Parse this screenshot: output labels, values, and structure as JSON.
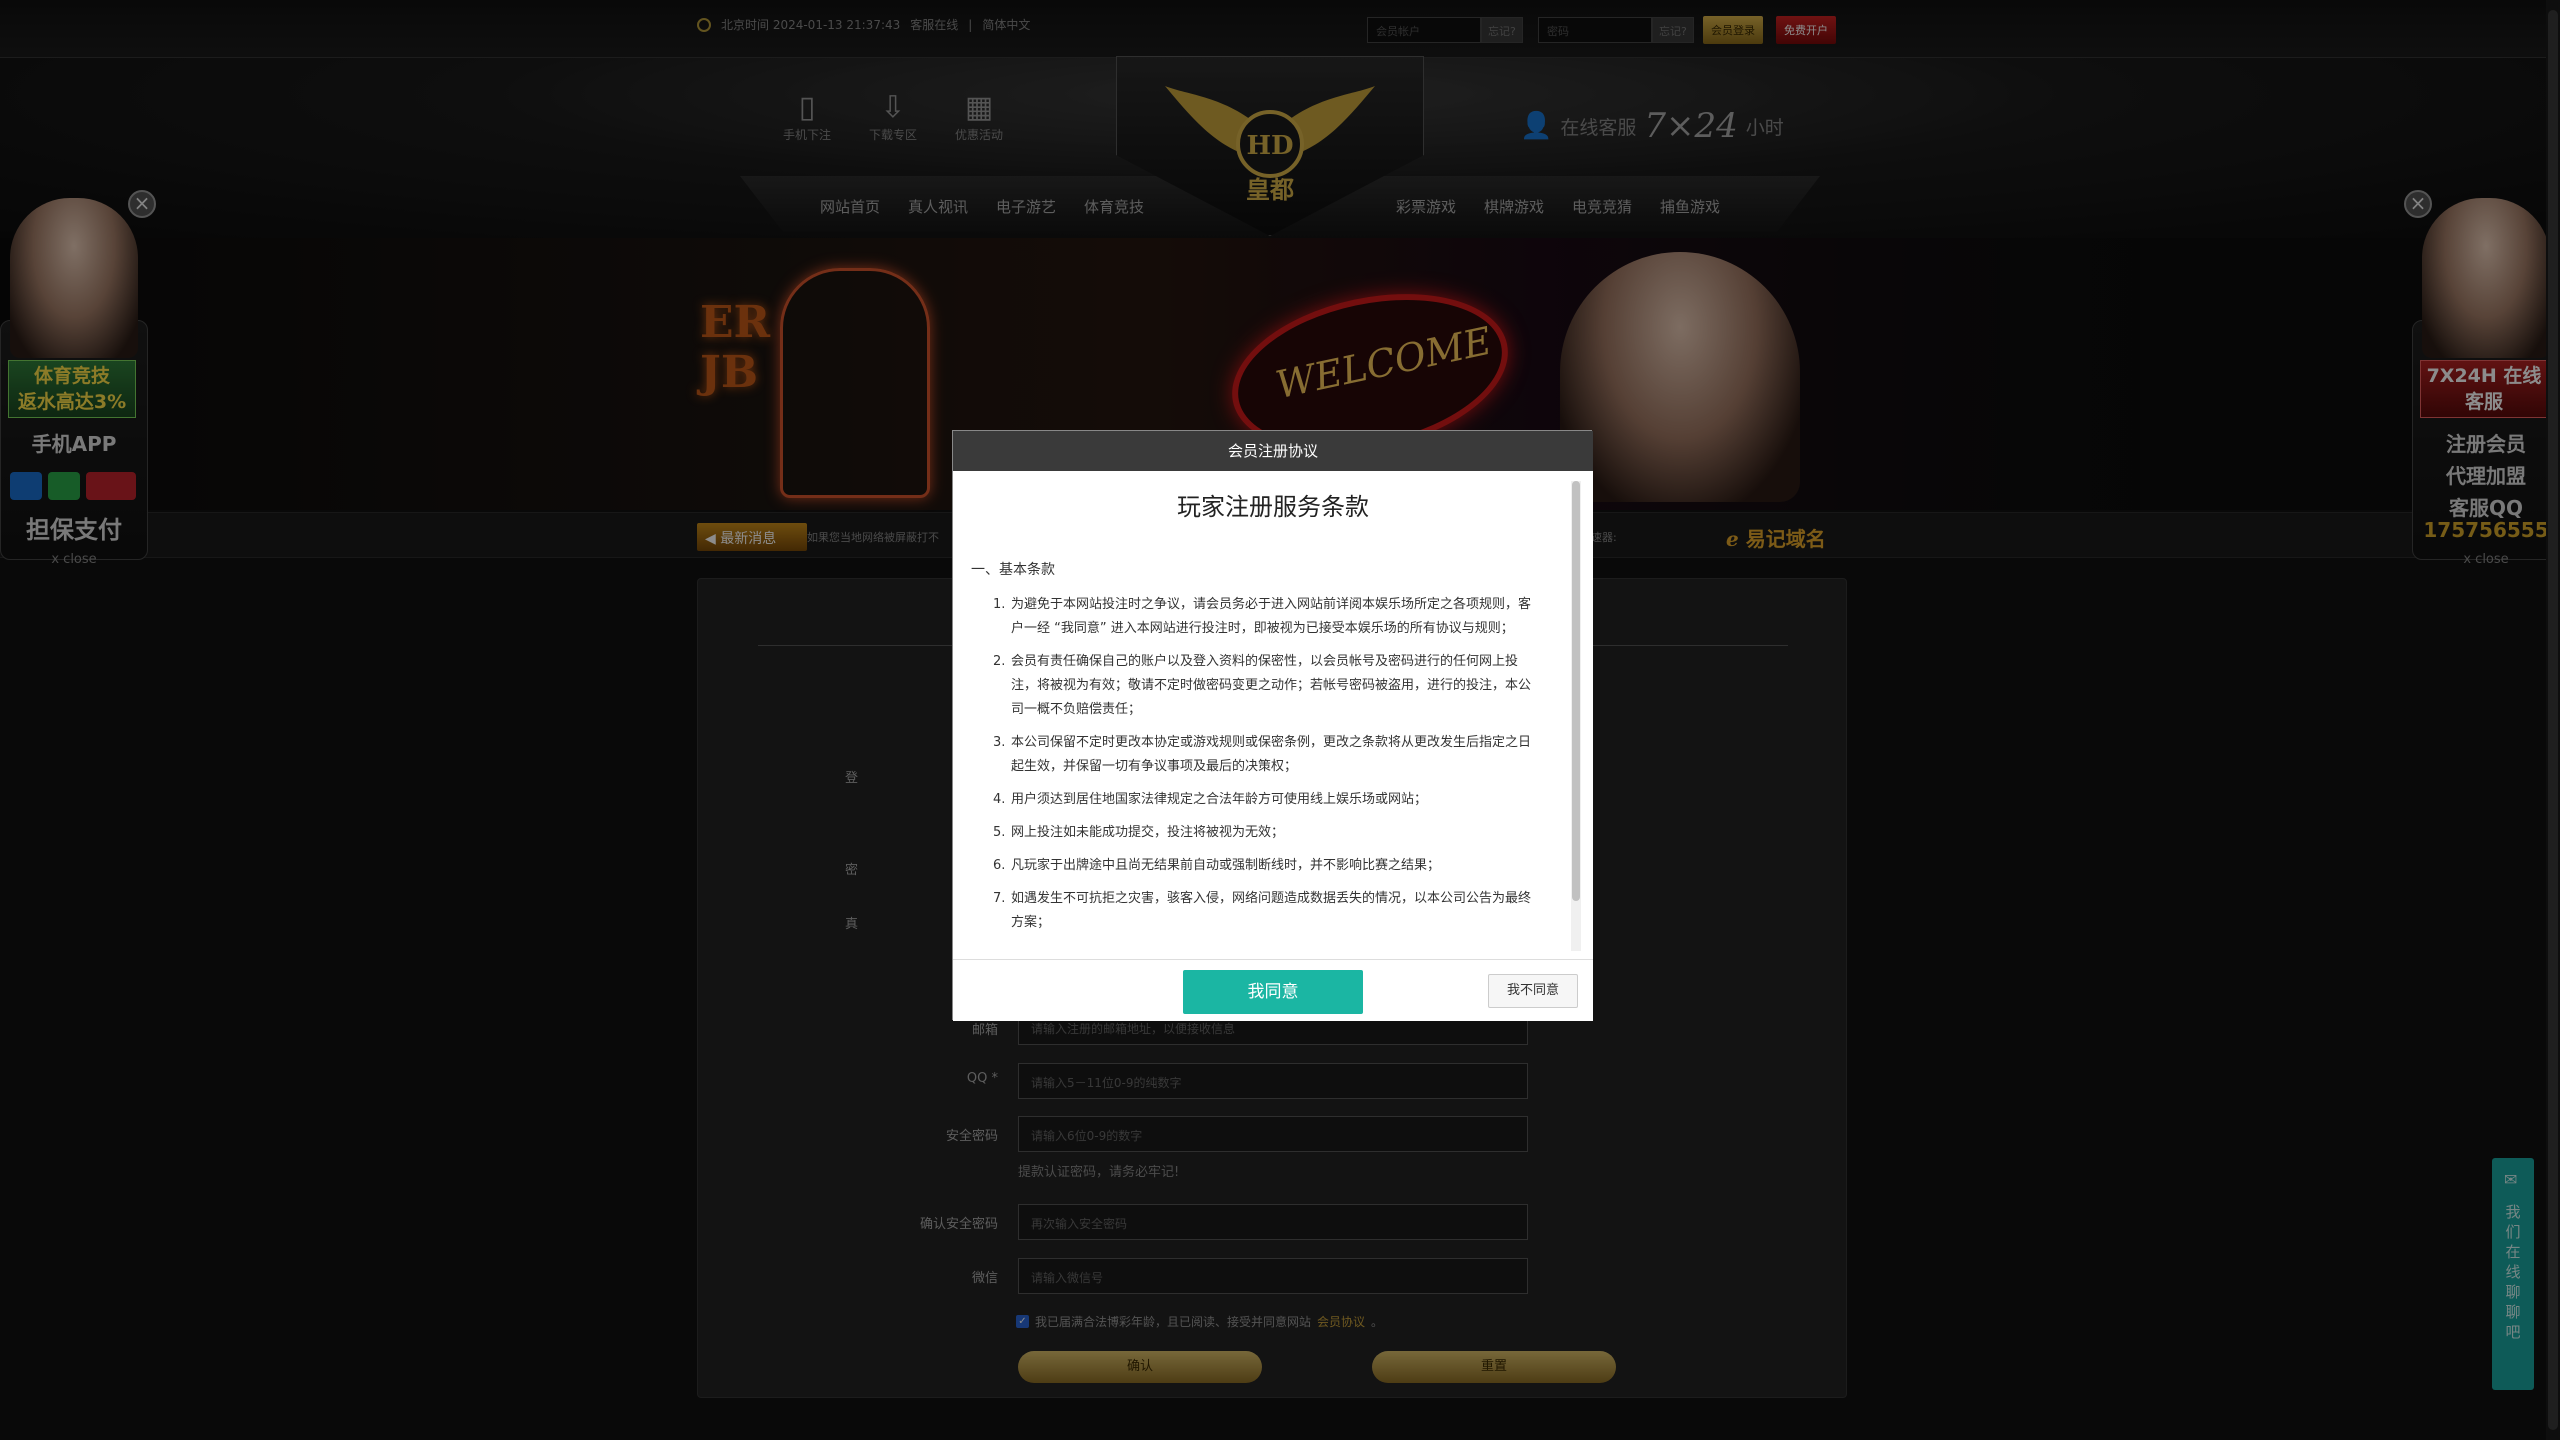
{
  "topbar": {
    "time": "北京时间 2024-01-13 21:37:43",
    "service_link": "客服在线",
    "lang": "简体中文",
    "account_placeholder": "会员帐户",
    "forgot_account": "忘记?",
    "password_placeholder": "密码",
    "forgot_password": "忘记?",
    "login": "会员登录",
    "register": "免费开户"
  },
  "header": {
    "quick": [
      {
        "label": "手机下注",
        "icon": "mobile-icon"
      },
      {
        "label": "下载专区",
        "icon": "download-icon"
      },
      {
        "label": "优惠活动",
        "icon": "gift-icon"
      }
    ],
    "logo_text": "皇都",
    "logo_letters": "HD",
    "service_prefix": "在线客服",
    "service_hours": "7×24",
    "service_suffix": "小时"
  },
  "nav": {
    "left": [
      "网站首页",
      "真人视讯",
      "电子游艺",
      "体育竞技"
    ],
    "right": [
      "彩票游戏",
      "棋牌游戏",
      "电竞竞猜",
      "捕鱼游戏"
    ]
  },
  "banner": {
    "letters": "ER\nJB",
    "sign": "WELCOME"
  },
  "ticker": {
    "news_label": "最新消息",
    "news_text": "如果您当地网络被屏蔽打不",
    "accel": "加速器:",
    "domain_label": "易记域名"
  },
  "left_float": {
    "promo": "体育竞技\n返水高达3%",
    "app": "手机APP",
    "pay": "担保支付",
    "close": "x close"
  },
  "right_float": {
    "cs": "7X24H\n在线客服",
    "register": "注册会员",
    "agent": "代理加盟",
    "qq": "客服QQ",
    "qq_num": "175756555",
    "close": "x close"
  },
  "form": {
    "row_labels": [
      "登",
      "密",
      "真"
    ],
    "email_label": "邮箱",
    "email_placeholder": "请输入注册的邮箱地址，以便接收信息",
    "qq_label": "QQ *",
    "qq_placeholder": "请输入5－11位0-9的纯数字",
    "security_label": "安全密码",
    "security_placeholder": "请输入6位0-9的数字",
    "security_hint": "提款认证密码，请务必牢记!",
    "confirm_label": "确认安全密码",
    "confirm_placeholder": "再次输入安全密码",
    "wechat_label": "微信",
    "wechat_placeholder": "请输入微信号",
    "agree_text": "我已届满合法博彩年龄，且已阅读、接受并同意网站",
    "agree_link": "会员协议",
    "agree_end": "。",
    "submit": "确认",
    "reset": "重置"
  },
  "chat_tab": "我们在线聊聊吧",
  "modal": {
    "title": "会员注册协议",
    "heading": "玩家注册服务条款",
    "section": "一、基本条款",
    "items": [
      {
        "n": "1.",
        "text": "为避免于本网站投注时之争议，请会员务必于进入网站前详阅本娱乐场所定之各项规则，客户一经 “我同意” 进入本网站进行投注时，即被视为已接受本娱乐场的所有协议与规则；"
      },
      {
        "n": "2.",
        "text": "会员有责任确保自己的账户以及登入资料的保密性，以会员帐号及密码进行的任何网上投注，将被视为有效；敬请不定时做密码变更之动作；若帐号密码被盗用，进行的投注，本公司一概不负赔偿责任；"
      },
      {
        "n": "3.",
        "text": "本公司保留不定时更改本协定或游戏规则或保密条例，更改之条款将从更改发生后指定之日起生效，并保留一切有争议事项及最后的决策权；"
      },
      {
        "n": "4.",
        "text": "用户须达到居住地国家法律规定之合法年龄方可使用线上娱乐场或网站；"
      },
      {
        "n": "5.",
        "text": "网上投注如未能成功提交，投注将被视为无效；"
      },
      {
        "n": "6.",
        "text": "凡玩家于出牌途中且尚无结果前自动或强制断线时，并不影响比赛之结果；"
      },
      {
        "n": "7.",
        "text": "如遇发生不可抗拒之灾害，骇客入侵，网络问题造成数据丢失的情况，以本公司公告为最终方案；"
      }
    ],
    "agree": "我同意",
    "disagree": "我不同意"
  }
}
